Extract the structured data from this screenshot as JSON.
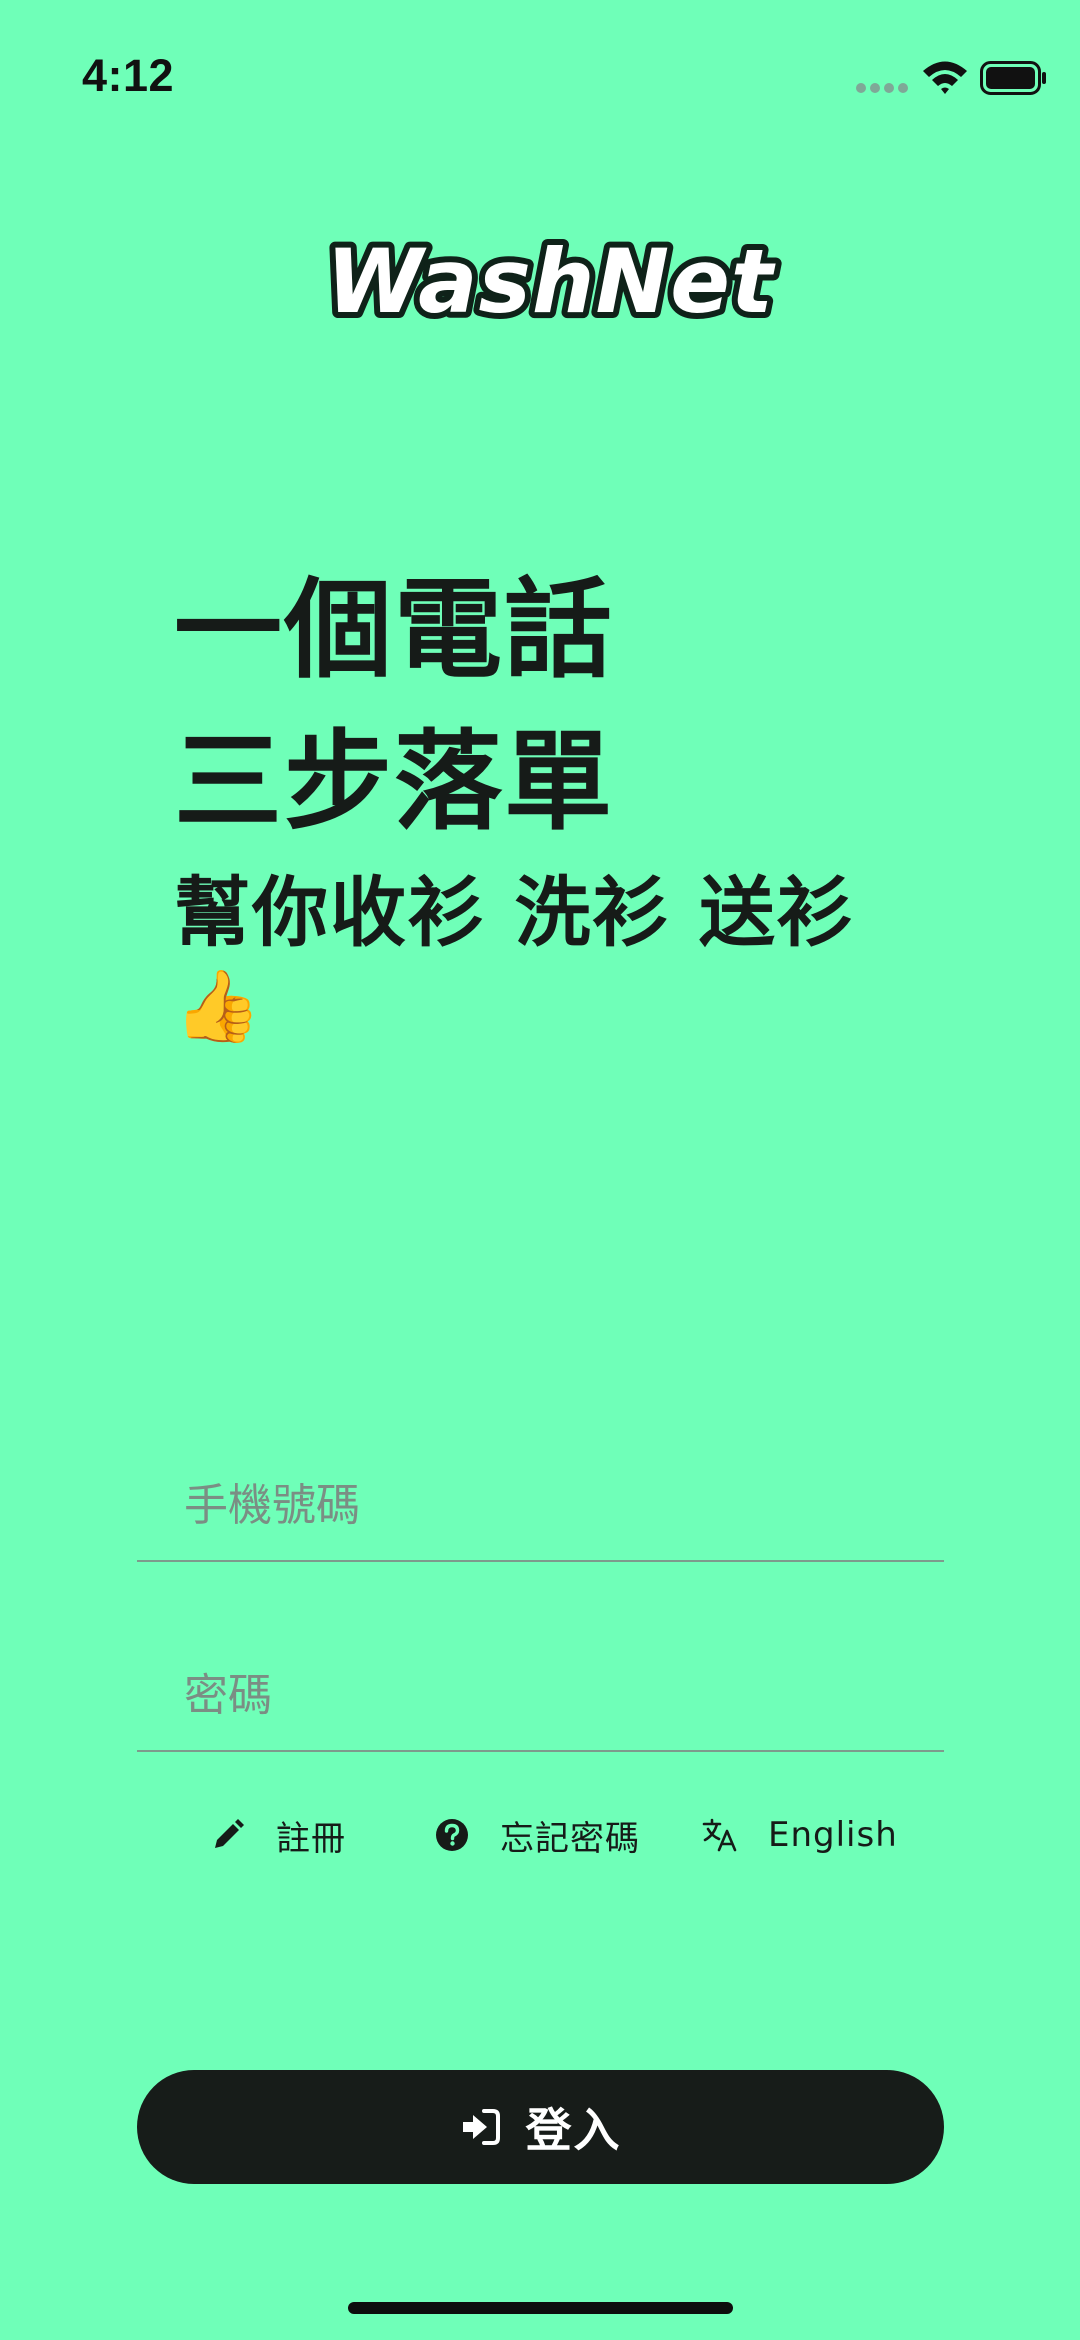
{
  "status_bar": {
    "time": "4:12",
    "icons": [
      "signal-dots-icon",
      "wifi-icon",
      "battery-icon"
    ]
  },
  "logo": {
    "text": "WashNet"
  },
  "headline": {
    "line1": "一個電話",
    "line2": "三步落單",
    "line3": "幫你收衫 洗衫 送衫",
    "emoji": "👍"
  },
  "form": {
    "phone": {
      "placeholder": "手機號碼",
      "value": ""
    },
    "password": {
      "placeholder": "密碼",
      "value": ""
    }
  },
  "links": {
    "register": {
      "label": "註冊",
      "icon": "pencil-icon"
    },
    "forgot_password": {
      "label": "忘記密碼",
      "icon": "question-circle-icon"
    },
    "language": {
      "label": "English",
      "icon": "translate-icon"
    }
  },
  "login_button": {
    "label": "登入",
    "icon": "sign-in-icon"
  },
  "colors": {
    "background": "#6fffb8",
    "text": "#161b18",
    "button": "#171c19",
    "logo_fill": "#ffffff",
    "logo_outline": "#0f2219"
  }
}
